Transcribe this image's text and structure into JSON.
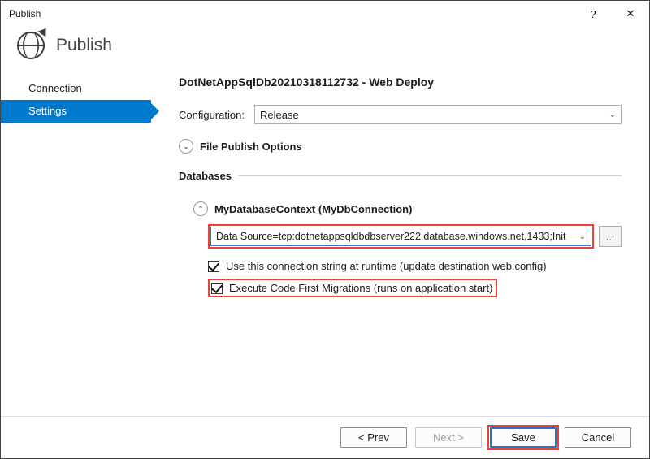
{
  "window": {
    "title": "Publish"
  },
  "header": {
    "title": "Publish"
  },
  "sidebar": {
    "items": [
      {
        "label": "Connection"
      },
      {
        "label": "Settings"
      }
    ]
  },
  "main": {
    "profile_name": "DotNetAppSqlDb20210318112732 - Web Deploy",
    "configuration_label": "Configuration:",
    "configuration_value": "Release",
    "file_publish_options_label": "File Publish Options",
    "databases_label": "Databases",
    "db_context_label": "MyDatabaseContext (MyDbConnection)",
    "connection_string": "Data Source=tcp:dotnetappsqldbdbserver222.database.windows.net,1433;Init",
    "use_conn_label": "Use this connection string at runtime (update destination web.config)",
    "execute_migrations_label": "Execute Code First Migrations (runs on application start)"
  },
  "footer": {
    "prev": "< Prev",
    "next": "Next >",
    "save": "Save",
    "cancel": "Cancel"
  }
}
